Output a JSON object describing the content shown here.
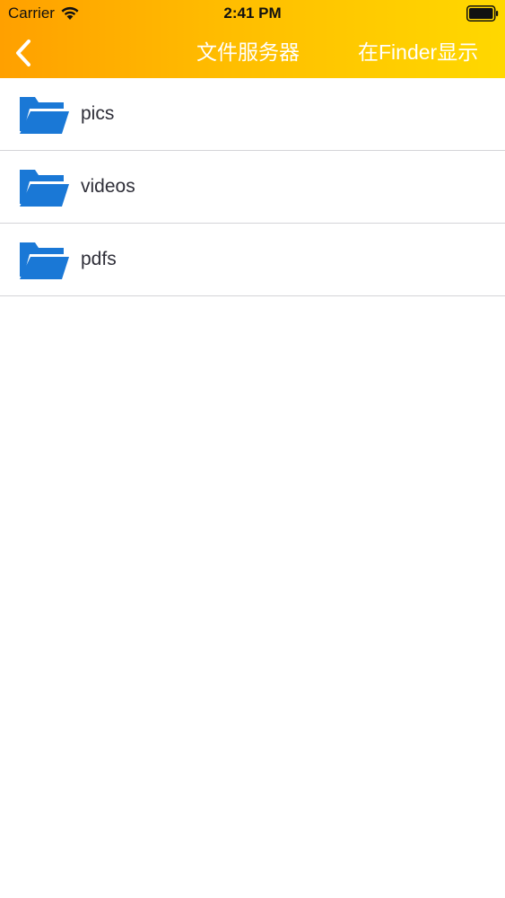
{
  "status_bar": {
    "carrier": "Carrier",
    "time": "2:41 PM",
    "wifi_icon": "wifi-icon",
    "battery_icon": "battery-icon"
  },
  "nav": {
    "back_icon": "chevron-left-icon",
    "title": "文件服务器",
    "right_action": "在Finder显示",
    "gradient_start": "#ffa000",
    "gradient_end": "#ffd800"
  },
  "folders": {
    "icon": "folder-open-icon",
    "icon_color": "#1a78d6",
    "items": [
      {
        "label": "pics"
      },
      {
        "label": "videos"
      },
      {
        "label": "pdfs"
      }
    ]
  }
}
